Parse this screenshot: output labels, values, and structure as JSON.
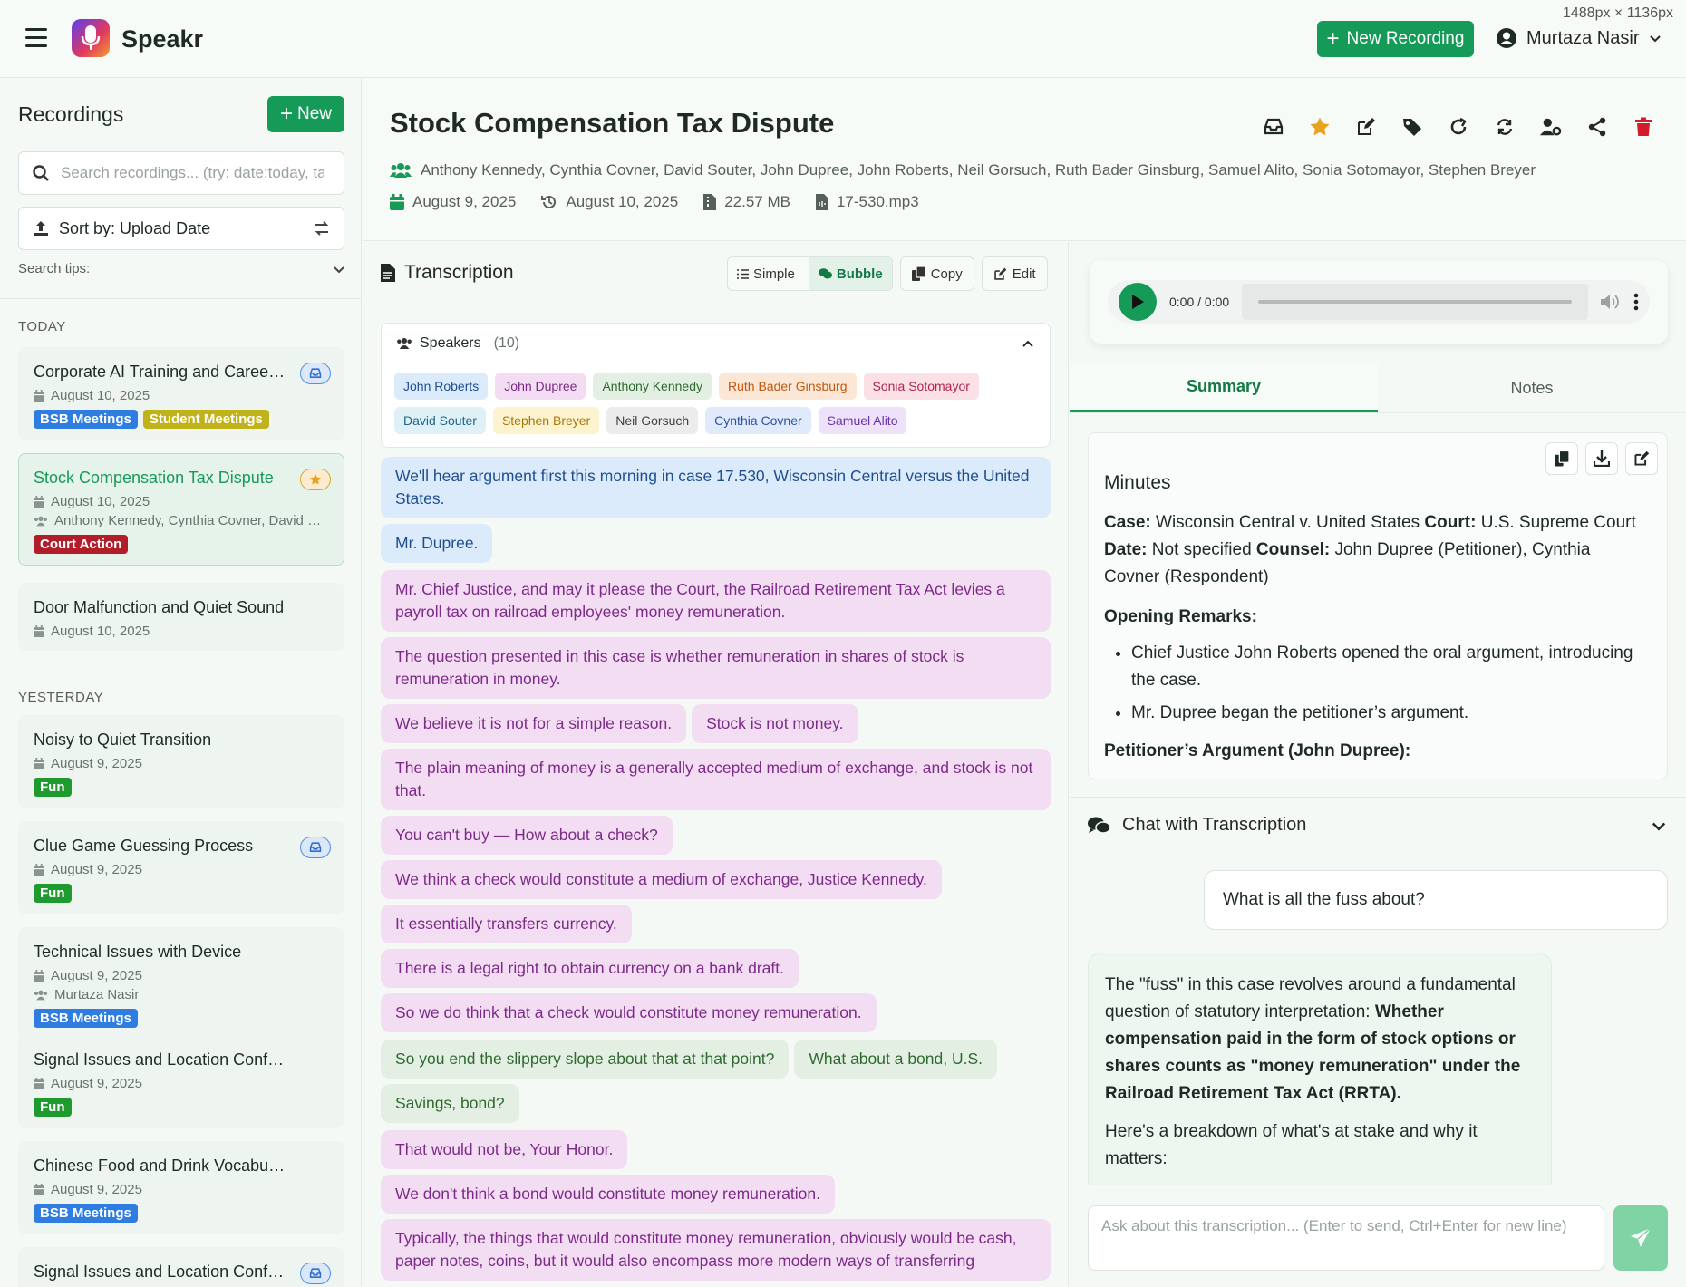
{
  "app": {
    "name": "Speakr",
    "dimensions_label": "1488px × 1136px"
  },
  "header": {
    "new_recording_label": "New Recording",
    "user_name": "Murtaza Nasir"
  },
  "sidebar": {
    "title": "Recordings",
    "new_label": "New",
    "search_placeholder": "Search recordings... (try: date:today, tag:meeting)",
    "sort_label": "Sort by: Upload Date",
    "search_tips_label": "Search tips:",
    "today_label": "TODAY",
    "yesterday_label": "YESTERDAY",
    "recordings": [
      {
        "title": "Corporate AI Training and Career Development",
        "date": "August 10, 2025",
        "tags": [
          {
            "label": "BSB Meetings",
            "color": "#2f7de1"
          },
          {
            "label": "Student Meetings",
            "color": "#c0b21a"
          }
        ],
        "badge": "inbox"
      },
      {
        "title": "Stock Compensation Tax Dispute",
        "date": "August 10, 2025",
        "participants": "Anthony Kennedy, Cynthia Covner, David Souter, John Dupree",
        "tags": [
          {
            "label": "Court Action",
            "color": "#b11e2a"
          }
        ],
        "badge": "star"
      },
      {
        "title": "Door Malfunction and Quiet Sound",
        "date": "August 10, 2025"
      },
      {
        "title": "Noisy to Quiet Transition",
        "date": "August 9, 2025",
        "tags": [
          {
            "label": "Fun",
            "color": "#1f9a2e"
          }
        ]
      },
      {
        "title": "Clue Game Guessing Process",
        "date": "August 9, 2025",
        "tags": [
          {
            "label": "Fun",
            "color": "#1f9a2e"
          }
        ],
        "badge": "inbox"
      },
      {
        "title": "Technical Issues with Device",
        "date": "August 9, 2025",
        "participants": "Murtaza Nasir",
        "tags": [
          {
            "label": "BSB Meetings",
            "color": "#2f7de1"
          }
        ]
      },
      {
        "title": "Signal Issues and Location Confusion",
        "date": "August 9, 2025",
        "tags": [
          {
            "label": "Fun",
            "color": "#1f9a2e"
          }
        ]
      },
      {
        "title": "Chinese Food and Drink Vocabulary",
        "date": "August 9, 2025",
        "tags": [
          {
            "label": "BSB Meetings",
            "color": "#2f7de1"
          }
        ]
      },
      {
        "title": "Signal Issues and Location Confusion",
        "date": "",
        "badge": "inbox"
      }
    ]
  },
  "recording": {
    "title": "Stock Compensation Tax Dispute",
    "participants": "Anthony Kennedy, Cynthia Covner, David Souter, John Dupree, John Roberts, Neil Gorsuch, Ruth Bader Ginsburg, Samuel Alito, Sonia Sotomayor, Stephen Breyer",
    "meeting_date": "August 9, 2025",
    "upload_date": "August 10, 2025",
    "file_size": "22.57 MB",
    "file_name": "17-530.mp3"
  },
  "transcription": {
    "title": "Transcription",
    "view_simple": "Simple",
    "view_bubble": "Bubble",
    "copy_label": "Copy",
    "edit_label": "Edit",
    "speakers_label": "Speakers",
    "speakers_count": "(10)",
    "speakers": [
      {
        "name": "John Roberts",
        "bg": "#dcebfb",
        "fg": "#1e4f91"
      },
      {
        "name": "John Dupree",
        "bg": "#f3ddf2",
        "fg": "#7d2a8a"
      },
      {
        "name": "Anthony Kennedy",
        "bg": "#e3efe3",
        "fg": "#2f6a2f"
      },
      {
        "name": "Ruth Bader Ginsburg",
        "bg": "#fce7d6",
        "fg": "#c2580c"
      },
      {
        "name": "Sonia Sotomayor",
        "bg": "#fbe0e6",
        "fg": "#b3254a"
      },
      {
        "name": "David Souter",
        "bg": "#dff1f7",
        "fg": "#1b6785"
      },
      {
        "name": "Stephen Breyer",
        "bg": "#fdf3cf",
        "fg": "#a8770a"
      },
      {
        "name": "Neil Gorsuch",
        "bg": "#ececec",
        "fg": "#444444"
      },
      {
        "name": "Cynthia Covner",
        "bg": "#e1eafb",
        "fg": "#2b55a5"
      },
      {
        "name": "Samuel Alito",
        "bg": "#eee2fa",
        "fg": "#6b32a8"
      }
    ],
    "rows": [
      {
        "gap": false,
        "bubbles": [
          {
            "text": "We'll hear argument first this morning in case 17.530, Wisconsin Central versus the United States.",
            "style": "b-blue"
          }
        ]
      },
      {
        "gap": false,
        "bubbles": [
          {
            "text": "Mr. Dupree.",
            "style": "b-blue"
          }
        ]
      },
      {
        "gap": true,
        "bubbles": [
          {
            "text": "Mr. Chief Justice, and may it please the Court, the Railroad Retirement Tax Act levies a payroll tax on railroad employees' money remuneration.",
            "style": "b-purple"
          }
        ]
      },
      {
        "gap": false,
        "bubbles": [
          {
            "text": "The question presented in this case is whether remuneration in shares of stock is remuneration in money.",
            "style": "b-purple"
          }
        ]
      },
      {
        "gap": false,
        "bubbles": [
          {
            "text": "We believe it is not for a simple reason.",
            "style": "b-purple"
          },
          {
            "text": "Stock is not money.",
            "style": "b-purple"
          }
        ]
      },
      {
        "gap": false,
        "bubbles": [
          {
            "text": "The plain meaning of money is a generally accepted medium of exchange, and stock is not that.",
            "style": "b-purple"
          }
        ]
      },
      {
        "gap": false,
        "bubbles": [
          {
            "text": "You can't buy — How about a check?",
            "style": "b-purple"
          }
        ]
      },
      {
        "gap": false,
        "bubbles": [
          {
            "text": "We think a check would constitute a medium of exchange, Justice Kennedy.",
            "style": "b-purple"
          }
        ]
      },
      {
        "gap": false,
        "bubbles": [
          {
            "text": "It essentially transfers currency.",
            "style": "b-purple"
          },
          {
            "text": "There is a legal right to obtain currency on a bank draft.",
            "style": "b-purple"
          }
        ]
      },
      {
        "gap": false,
        "bubbles": [
          {
            "text": "So we do think that a check would constitute money remuneration.",
            "style": "b-purple"
          }
        ]
      },
      {
        "gap": true,
        "bubbles": [
          {
            "text": "So you end the slippery slope about that at that point?",
            "style": "b-green"
          },
          {
            "text": "What about a bond, U.S.",
            "style": "b-green"
          }
        ]
      },
      {
        "gap": false,
        "bubbles": [
          {
            "text": "Savings, bond?",
            "style": "b-green"
          }
        ]
      },
      {
        "gap": true,
        "bubbles": [
          {
            "text": "That would not be, Your Honor.",
            "style": "b-purple"
          }
        ]
      },
      {
        "gap": false,
        "bubbles": [
          {
            "text": "We don't think a bond would constitute money remuneration.",
            "style": "b-purple"
          }
        ]
      },
      {
        "gap": false,
        "bubbles": [
          {
            "text": "Typically, the things that would constitute money remuneration, obviously would be cash, paper notes, coins, but it would also encompass more modern ways of transferring",
            "style": "b-purple"
          }
        ]
      }
    ]
  },
  "player": {
    "time": "0:00 / 0:00",
    "progress": 0
  },
  "tabs": {
    "summary": "Summary",
    "notes": "Notes"
  },
  "summary": {
    "heading": "Minutes",
    "case_label": "Case:",
    "case_value": "Wisconsin Central v. United States",
    "court_label": "Court:",
    "court_value": "U.S. Supreme Court",
    "date_label": "Date:",
    "date_value": "Not specified",
    "counsel_label": "Counsel:",
    "counsel_value": "John Dupree (Petitioner), Cynthia Covner (Respondent)",
    "opening_label": "Opening Remarks:",
    "opening_items": [
      "Chief Justice John Roberts opened the oral argument, introducing the case.",
      "Mr. Dupree began the petitioner’s argument."
    ],
    "petitioner_label": "Petitioner’s Argument (John Dupree):"
  },
  "chat": {
    "title": "Chat with Transcription",
    "question": "What is all the fuss about?",
    "answer_intro": "The \"fuss\" in this case revolves around a fundamental question of statutory interpretation: ",
    "answer_bold": "Whether compensation paid in the form of stock options or shares counts as \"money remuneration\" under the Railroad Retirement Tax Act (RRTA).",
    "answer_more": "Here's a breakdown of what's at stake and why it matters:",
    "input_placeholder": "Ask about this transcription... (Enter to send, Ctrl+Enter for new line)"
  }
}
